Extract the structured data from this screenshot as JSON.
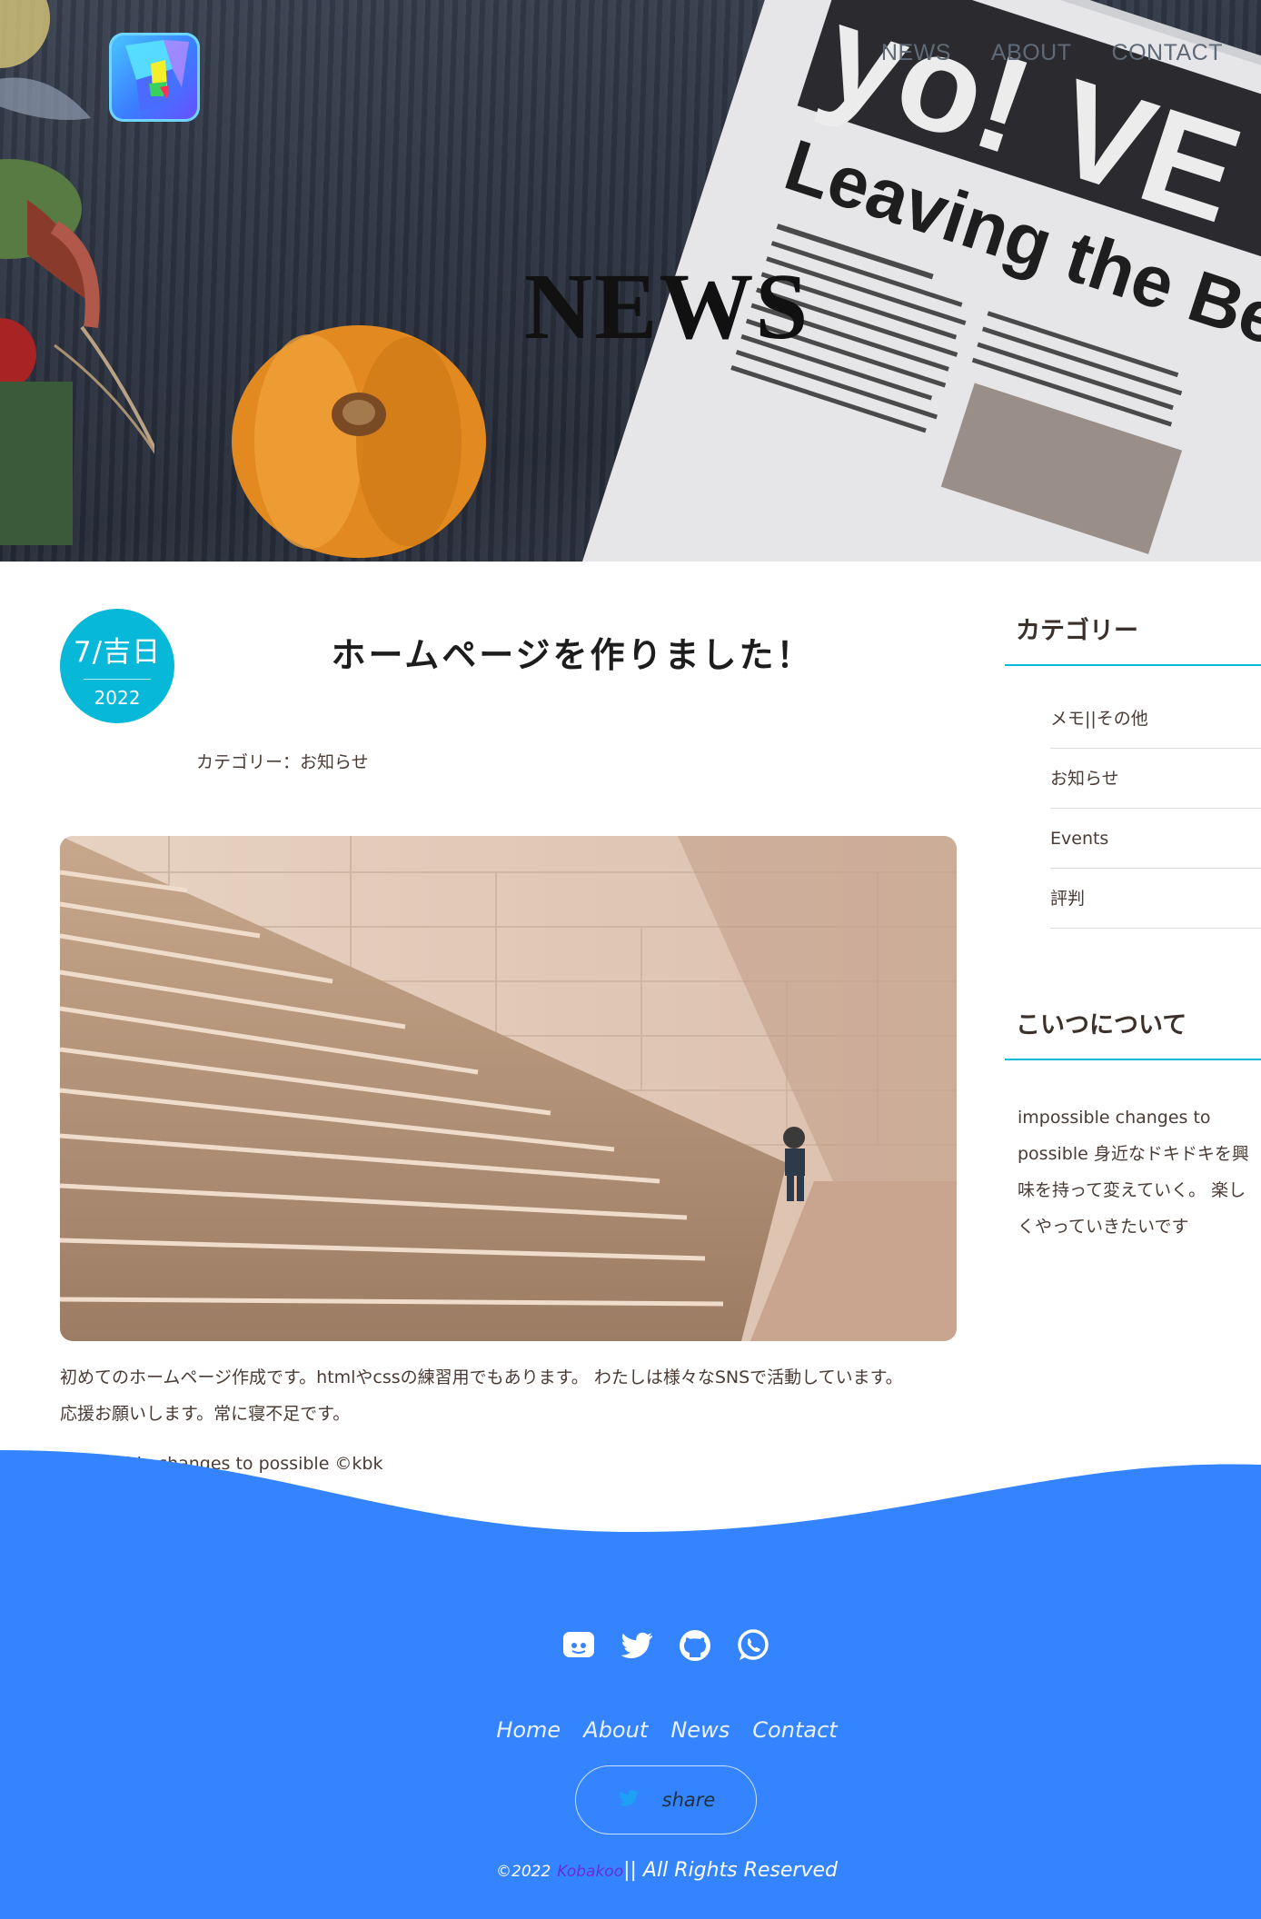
{
  "nav": {
    "items": [
      "NEWS",
      "ABOUT",
      "CONTACT"
    ]
  },
  "hero": {
    "title": "NEWS"
  },
  "post": {
    "date_day": "7/吉日",
    "date_year": "2022",
    "title": "ホームページを作りました！",
    "category": "カテゴリー：お知らせ",
    "body_line1": "初めてのホームページ作成です。htmlやcssの練習用でもあります。 わたしは様々なSNSで活動しています。",
    "body_line2": "応援お願いします。常に寝不足です。",
    "signature": "impossible changes to possible ©kbk"
  },
  "sidebar": {
    "category_heading": "カテゴリー",
    "categories": [
      "メモ||その他",
      "お知らせ",
      "Events",
      "評判"
    ],
    "about_heading": "こいつについて",
    "about_text": "impossible changes to possible 身近なドキドキを興味を持って変えていく。 楽しくやっていきたいです"
  },
  "footer": {
    "social_icons": [
      "discord-icon",
      "twitter-icon",
      "github-icon",
      "whatsapp-icon"
    ],
    "links": [
      "Home",
      "About",
      "News",
      "Contact"
    ],
    "share_label": "share",
    "copyright_prefix": "©2022",
    "copyright_brand": "Kobakoo",
    "copyright_suffix": "|| All Rights Reserved"
  },
  "colors": {
    "accent": "#07b8d8",
    "footer_bg": "#3584ff",
    "brand_text": "#6b2bd6"
  }
}
